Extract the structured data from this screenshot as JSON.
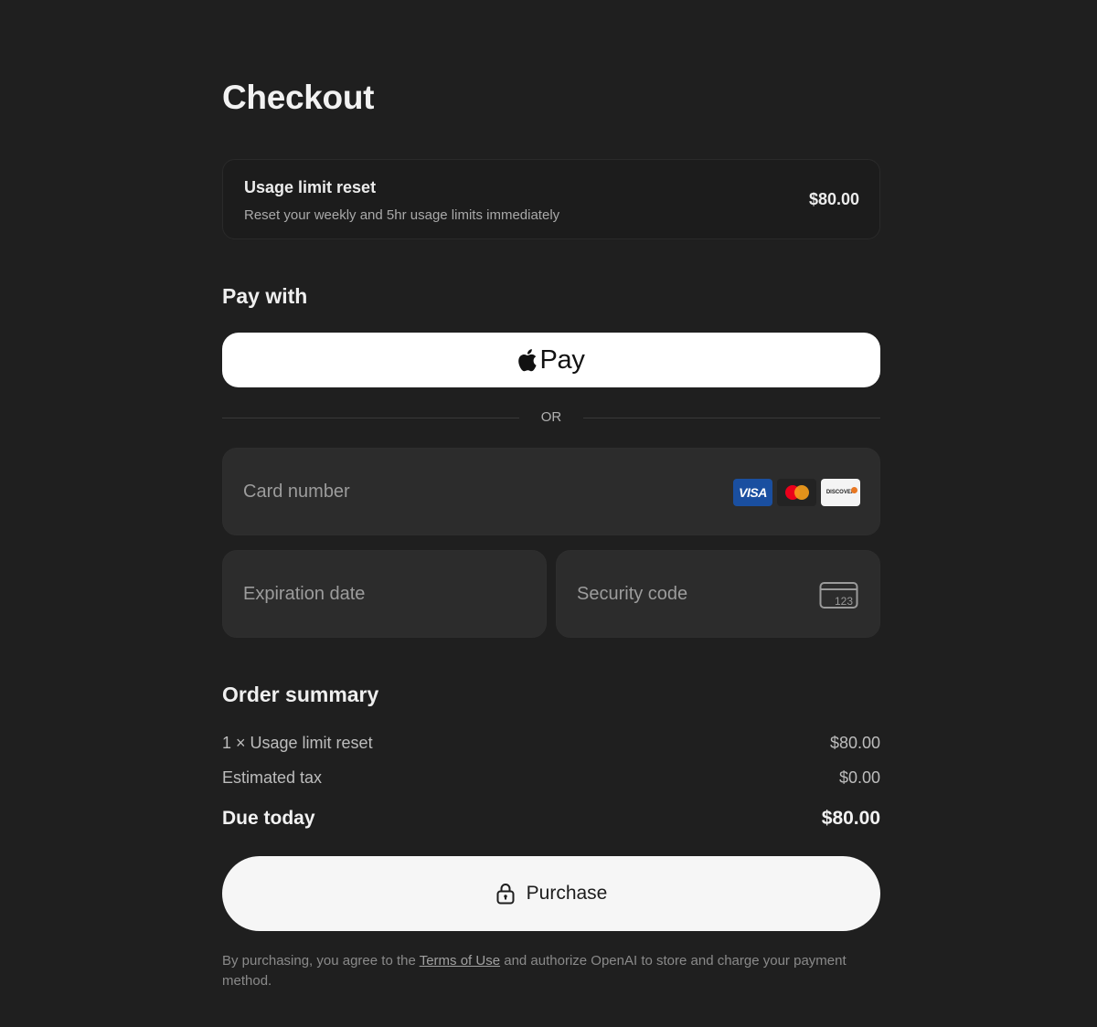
{
  "page": {
    "title": "Checkout"
  },
  "product": {
    "name": "Usage limit reset",
    "description": "Reset your weekly and 5hr usage limits immediately",
    "price": "$80.00"
  },
  "payment": {
    "section_title": "Pay with",
    "apple_pay_label": "Pay",
    "divider_text": "OR",
    "card_number_placeholder": "Card number",
    "expiration_placeholder": "Expiration date",
    "security_code_placeholder": "Security code",
    "card_brands": [
      "VISA",
      "mastercard",
      "DISCOVER"
    ],
    "cvc_hint": "123"
  },
  "summary": {
    "section_title": "Order summary",
    "line_item_label": "1 × Usage limit reset",
    "line_item_value": "$80.00",
    "tax_label": "Estimated tax",
    "tax_value": "$0.00",
    "total_label": "Due today",
    "total_value": "$80.00"
  },
  "purchase": {
    "label": "Purchase"
  },
  "legal": {
    "prefix": "By purchasing, you agree to the ",
    "link_text": "Terms of Use",
    "suffix": " and authorize OpenAI to store and charge your payment method."
  },
  "colors": {
    "background": "#1f1f1f",
    "input_background": "#2c2c2c",
    "button_background": "#ffffff"
  }
}
